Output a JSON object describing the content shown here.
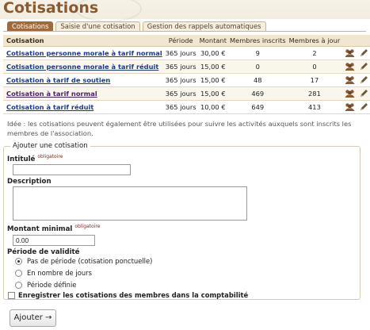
{
  "page": {
    "title": "Cotisations"
  },
  "tabs": [
    {
      "label": "Cotisations",
      "active": true
    },
    {
      "label": "Saisie d'une cotisation",
      "active": false
    },
    {
      "label": "Gestion des rappels automatiques",
      "active": false
    }
  ],
  "table": {
    "headers": [
      "Cotisation",
      "Période",
      "Montant",
      "Membres inscrits",
      "Membres à jour",
      ""
    ],
    "rows": [
      {
        "name": "Cotisation personne morale à tarif normal",
        "periode": "365 jours",
        "montant": "30,00 €",
        "inscrits": "9",
        "a_jour": "2"
      },
      {
        "name": "Cotisation personne morale à tarif réduit",
        "periode": "365 jours",
        "montant": "15,00 €",
        "inscrits": "0",
        "a_jour": "0"
      },
      {
        "name": "Cotisation à tarif de soutien",
        "periode": "365 jours",
        "montant": "15,00 €",
        "inscrits": "48",
        "a_jour": "17"
      },
      {
        "name": "Cotisation à tarif normal",
        "periode": "365 jours",
        "montant": "15,00 €",
        "inscrits": "469",
        "a_jour": "281"
      },
      {
        "name": "Cotisation à tarif réduit",
        "periode": "365 jours",
        "montant": "10,00 €",
        "inscrits": "649",
        "a_jour": "413"
      }
    ],
    "row_actions": [
      "members-icon",
      "edit-pencil-icon",
      "delete-x-icon"
    ]
  },
  "idea_text": "Idée : les cotisations peuvent également être utilisées pour suivre les activités auxquels sont inscrits les membres de l'association.",
  "form": {
    "legend": "Ajouter une cotisation",
    "intitule_label": "Intitulé",
    "required_tag": "obligatoire",
    "intitule_value": "",
    "description_label": "Description",
    "description_value": "",
    "montant_label": "Montant minimal",
    "montant_value": "0.00",
    "periode_label": "Période de validité",
    "periode_options": [
      {
        "label": "Pas de période (cotisation ponctuelle)",
        "selected": true
      },
      {
        "label": "En nombre de jours",
        "selected": false
      },
      {
        "label": "Période définie",
        "selected": false
      }
    ],
    "compta_label": "Enregistrer les cotisations des membres dans la comptabilité",
    "compta_checked": false,
    "submit_label": "Ajouter →"
  },
  "colors": {
    "title": "#8a5a32",
    "tab_active": "#a06a3c",
    "link": "#1a3a8a",
    "icon": "#8a5a32"
  }
}
